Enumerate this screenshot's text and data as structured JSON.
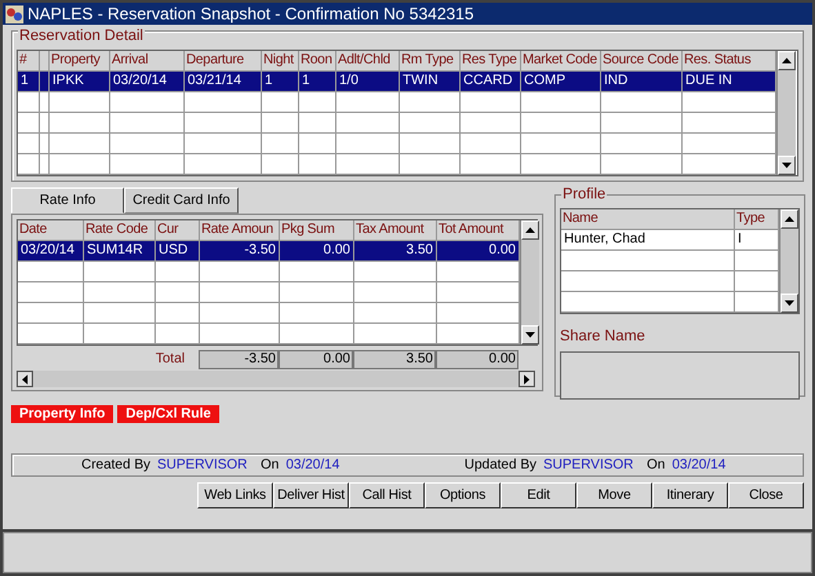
{
  "window": {
    "title": "NAPLES - Reservation Snapshot - Confirmation No 5342315"
  },
  "reservation_detail": {
    "title": "Reservation Detail",
    "columns": [
      "#",
      "Property",
      "Arrival",
      "Departure",
      "Night",
      "Roon",
      "Adlt/Chld",
      "Rm Type",
      "Res Type",
      "Market Code",
      "Source Code",
      "Res. Status"
    ],
    "rows": [
      {
        "selected": true,
        "cells": [
          "1",
          "IPKK",
          "03/20/14",
          "03/21/14",
          "1",
          "1",
          "1/0",
          "TWIN",
          "CCARD",
          "COMP",
          "IND",
          "DUE IN"
        ]
      }
    ]
  },
  "tabs": [
    {
      "label": "Rate Info",
      "selected": true
    },
    {
      "label": "Credit Card Info",
      "selected": false
    }
  ],
  "rate_table": {
    "columns": [
      "Date",
      "Rate Code",
      "Cur",
      "Rate Amoun",
      "Pkg Sum",
      "Tax Amount",
      "Tot Amount"
    ],
    "rows": [
      {
        "selected": true,
        "cells": [
          "03/20/14",
          "SUM14R",
          "USD",
          "-3.50",
          "0.00",
          "3.50",
          "0.00"
        ]
      }
    ],
    "total_label": "Total",
    "totals": [
      "-3.50",
      "0.00",
      "3.50",
      "0.00"
    ]
  },
  "profile": {
    "title": "Profile",
    "columns": [
      "Name",
      "Type"
    ],
    "rows": [
      {
        "selected": false,
        "cells": [
          "Hunter, Chad",
          "I"
        ]
      }
    ],
    "share_name_label": "Share Name"
  },
  "flag_buttons": [
    "Property Info",
    "Dep/Cxl Rule"
  ],
  "audit": [
    {
      "label": "Created By",
      "value": "SUPERVISOR"
    },
    {
      "label": "On",
      "value": "03/20/14"
    },
    {
      "label": "Updated By",
      "value": "SUPERVISOR"
    },
    {
      "label": "On",
      "value": "03/20/14"
    }
  ],
  "buttons": [
    "Web Links",
    "Deliver Hist",
    "Call Hist",
    "Options",
    "Edit",
    "Move",
    "Itinerary",
    "Close"
  ]
}
